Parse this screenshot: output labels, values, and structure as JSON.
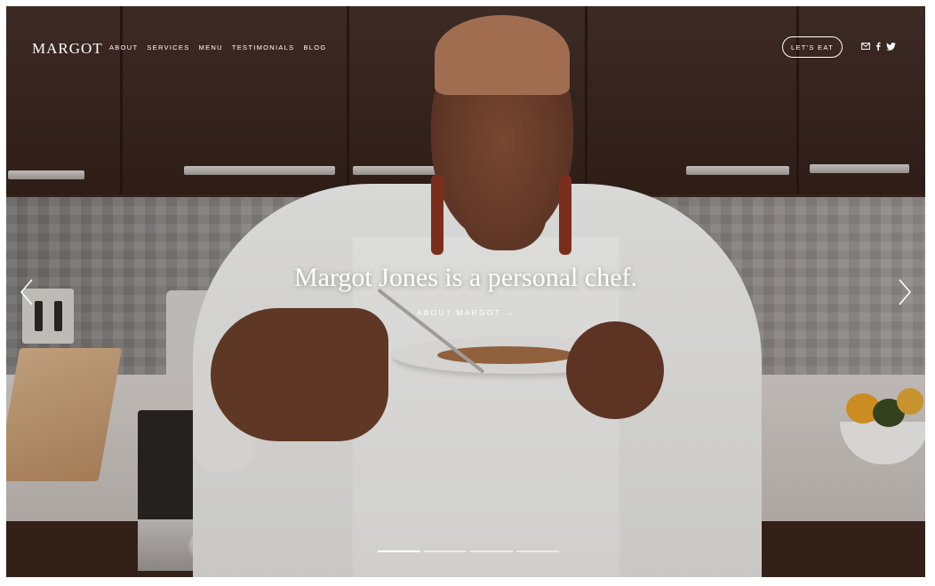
{
  "brand": {
    "logo": "MARGOT"
  },
  "nav": {
    "items": [
      {
        "label": "ABOUT"
      },
      {
        "label": "SERVICES"
      },
      {
        "label": "MENU"
      },
      {
        "label": "TESTIMONIALS"
      },
      {
        "label": "BLOG"
      }
    ]
  },
  "header": {
    "cta_label": "LET'S EAT",
    "social_icons": [
      "mail-icon",
      "facebook-icon",
      "twitter-icon"
    ]
  },
  "hero": {
    "headline": "Margot Jones is a personal chef.",
    "link_label": "ABOUT MARGOT →",
    "slides_count": 4,
    "active_slide": 1,
    "prev_icon": "chevron-left-icon",
    "next_icon": "chevron-right-icon"
  },
  "colors": {
    "text": "#ffffff",
    "background": "#3a2620"
  }
}
